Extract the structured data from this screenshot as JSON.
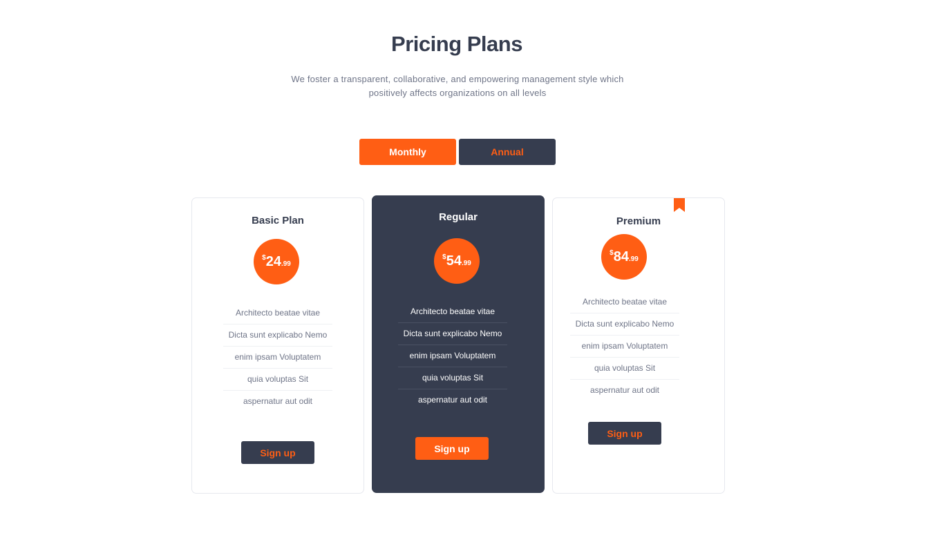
{
  "header": {
    "title": "Pricing Plans",
    "subtitle_line1": "We foster a transparent, collaborative, and empowering management style which",
    "subtitle_line2": "positively affects organizations on all levels"
  },
  "toggle": {
    "monthly_label": "Monthly",
    "annual_label": "Annual",
    "selected": "Monthly"
  },
  "plans": [
    {
      "name": "Basic Plan",
      "currency": "$",
      "price_whole": "24",
      "price_cents": ".99",
      "features": [
        "Architecto beatae vitae",
        "Dicta sunt explicabo Nemo",
        "enim ipsam Voluptatem",
        "quia voluptas Sit",
        "aspernatur aut odit"
      ],
      "button_label": "Sign up"
    },
    {
      "name": "Regular",
      "currency": "$",
      "price_whole": "54",
      "price_cents": ".99",
      "features": [
        "Architecto beatae vitae",
        "Dicta sunt explicabo Nemo",
        "enim ipsam Voluptatem",
        "quia voluptas Sit",
        "aspernatur aut odit"
      ],
      "button_label": "Sign up"
    },
    {
      "name": "Premium",
      "currency": "$",
      "price_whole": "84",
      "price_cents": ".99",
      "features": [
        "Architecto beatae vitae",
        "Dicta sunt explicabo Nemo",
        "enim ipsam Voluptatem",
        "quia voluptas Sit",
        "aspernatur aut odit"
      ],
      "button_label": "Sign up",
      "badge_icon": "bookmark-icon"
    }
  ],
  "colors": {
    "accent": "#ff5e14",
    "dark": "#363d4f",
    "muted_text": "#6e7487"
  }
}
